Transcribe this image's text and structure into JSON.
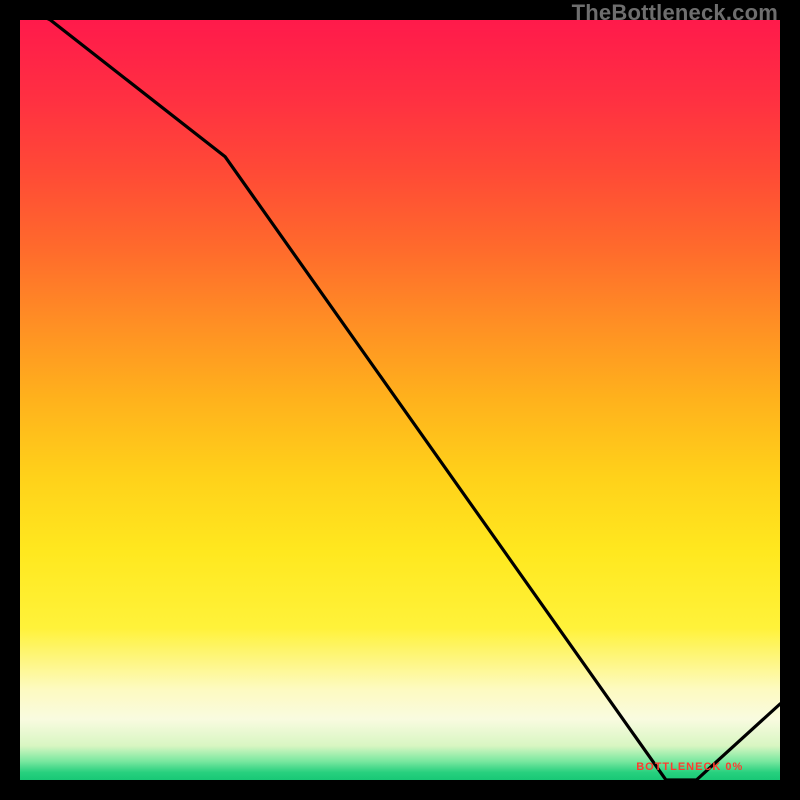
{
  "watermark": "TheBottleneck.com",
  "chart_data": {
    "type": "line",
    "x": [
      0.0,
      0.04,
      0.27,
      0.85,
      0.89,
      1.0
    ],
    "y": [
      1.02,
      1.0,
      0.82,
      0.0,
      0.0,
      0.1
    ],
    "xlabel": "",
    "ylabel": "",
    "xlim": [
      0,
      1
    ],
    "ylim": [
      0,
      1
    ],
    "grid": false,
    "legend": false,
    "note": "x and y are normalized to the plot-area box; values read from pixel positions"
  },
  "gradient_stops": [
    {
      "offset": 0.0,
      "color": "#ff1a4b"
    },
    {
      "offset": 0.1,
      "color": "#ff2f42"
    },
    {
      "offset": 0.2,
      "color": "#ff4a36"
    },
    {
      "offset": 0.3,
      "color": "#ff6a2c"
    },
    {
      "offset": 0.4,
      "color": "#ff8f24"
    },
    {
      "offset": 0.5,
      "color": "#ffb21c"
    },
    {
      "offset": 0.6,
      "color": "#ffd11a"
    },
    {
      "offset": 0.7,
      "color": "#ffe81f"
    },
    {
      "offset": 0.8,
      "color": "#fff23a"
    },
    {
      "offset": 0.88,
      "color": "#fdfac0"
    },
    {
      "offset": 0.92,
      "color": "#f9fbe0"
    },
    {
      "offset": 0.955,
      "color": "#d8f6c2"
    },
    {
      "offset": 0.975,
      "color": "#7be8a0"
    },
    {
      "offset": 0.99,
      "color": "#27d07e"
    },
    {
      "offset": 1.0,
      "color": "#18c876"
    }
  ],
  "bottom_label": {
    "text": "BOTTLENECK 0%",
    "color": "#ff3b2f"
  }
}
